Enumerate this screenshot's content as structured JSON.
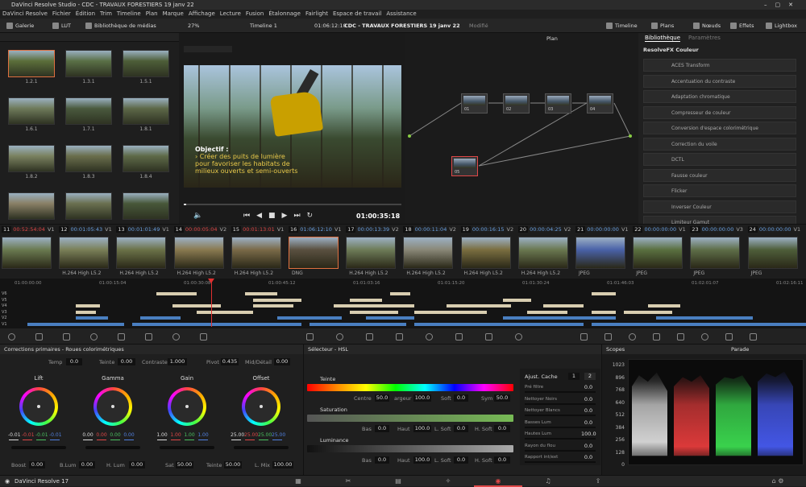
{
  "window": {
    "title": "DaVinci Resolve Studio - CDC - TRAVAUX FORESTIERS 19 janv 22"
  },
  "menu": [
    "DaVinci Resolve",
    "Fichier",
    "Édition",
    "Trim",
    "Timeline",
    "Plan",
    "Marque",
    "Affichage",
    "Lecture",
    "Fusion",
    "Étalonnage",
    "Fairlight",
    "Espace de travail",
    "Assistance"
  ],
  "toolbar": {
    "galerie": "Galerie",
    "lut": "LUT",
    "media": "Bibliothèque de médias",
    "zoom": "27%",
    "timeline_name": "Timeline 1",
    "timecode": "01:06:12:10",
    "project": "CDC - TRAVAUX FORESTIERS 19 janv 22",
    "modified": "Modifié",
    "timeline": "Timeline",
    "plans": "Plans",
    "noeuds": "Nœuds",
    "effets": "Effets",
    "lightbox": "Lightbox"
  },
  "gallery": {
    "labels": [
      "1.2.1",
      "1.3.1",
      "1.5.1",
      "1.6.1",
      "1.7.1",
      "1.8.1",
      "1.8.2",
      "1.8.3",
      "1.8.4",
      "",
      "",
      ""
    ]
  },
  "viewer": {
    "overlay_title": "Objectif :",
    "overlay_lines": [
      "› Créer des puits de lumière",
      "pour favoriser les habitats de",
      "milieux ouverts et semi-ouverts"
    ],
    "timecode": "01:00:35:18",
    "plan_label": "Plan"
  },
  "nodes": [
    "01",
    "02",
    "03",
    "04",
    "05"
  ],
  "library": {
    "tab1": "Bibliothèque",
    "tab2": "Paramètres",
    "section": "ResolveFX Couleur",
    "items": [
      "ACES Transform",
      "Accentuation du contraste",
      "Adaptation chromatique",
      "Compresseur de couleur",
      "Conversion d'espace colorimétrique",
      "Correction du voile",
      "DCTL",
      "Fausse couleur",
      "Flicker",
      "Inverser Couleur",
      "Limiteur Gamut"
    ]
  },
  "clips": [
    {
      "n": "11",
      "tc": "00:52:54:04",
      "tr": "V1",
      "codec": "",
      "red": true
    },
    {
      "n": "12",
      "tc": "00:01:05:43",
      "tr": "V1",
      "codec": "H.264 High L5.2",
      "red": false
    },
    {
      "n": "13",
      "tc": "00:01:01:49",
      "tr": "V1",
      "codec": "H.264 High L5.2",
      "red": false
    },
    {
      "n": "14",
      "tc": "00:00:05:04",
      "tr": "V2",
      "codec": "H.264 High L5.2",
      "red": true
    },
    {
      "n": "15",
      "tc": "00:01:13:01",
      "tr": "V1",
      "codec": "H.264 High L5.2",
      "red": true
    },
    {
      "n": "16",
      "tc": "01:06:12:10",
      "tr": "V1",
      "codec": "DNG",
      "red": false
    },
    {
      "n": "17",
      "tc": "00:00:13:39",
      "tr": "V2",
      "codec": "H.264 High L5.2",
      "red": false
    },
    {
      "n": "18",
      "tc": "00:00:11:04",
      "tr": "V2",
      "codec": "H.264 High L5.2",
      "red": false
    },
    {
      "n": "19",
      "tc": "00:00:16:15",
      "tr": "V2",
      "codec": "H.264 High L5.2",
      "red": false
    },
    {
      "n": "20",
      "tc": "00:00:04:25",
      "tr": "V2",
      "codec": "H.264 High L5.2",
      "red": false
    },
    {
      "n": "21",
      "tc": "00:00:00:00",
      "tr": "V1",
      "codec": "JPEG",
      "red": false
    },
    {
      "n": "22",
      "tc": "00:00:00:00",
      "tr": "V1",
      "codec": "JPEG",
      "red": false
    },
    {
      "n": "23",
      "tc": "00:00:00:00",
      "tr": "V3",
      "codec": "JPEG",
      "red": false
    },
    {
      "n": "24",
      "tc": "00:00:00:00",
      "tr": "V1",
      "codec": "JPEG",
      "red": false
    }
  ],
  "ruler": [
    "01:00:00:00",
    "01:00:15:04",
    "01:00:30:08",
    "01:00:45:12",
    "01:01:03:16",
    "01:01:15:20",
    "01:01:30:24",
    "01:01:46:03",
    "01:02:01:07",
    "01:02:16:11"
  ],
  "tracks": [
    "V6",
    "V5",
    "V4",
    "V3",
    "V2",
    "V1"
  ],
  "primaries": {
    "title": "Corrections primaires - Roues colorimétriques",
    "temp_label": "Temp",
    "temp": "0.0",
    "teinte_label": "Teinte",
    "teinte": "0.00",
    "contraste_label": "Contraste",
    "contraste": "1.000",
    "pivot_label": "Pivot",
    "pivot": "0.435",
    "mid_label": "Mid/Détail",
    "mid": "0.00",
    "wheels": [
      {
        "name": "Lift",
        "vals": [
          "-0.01",
          "-0.01",
          "-0.01",
          "-0.01"
        ]
      },
      {
        "name": "Gamma",
        "vals": [
          "0.00",
          "0.00",
          "0.00",
          "0.00"
        ]
      },
      {
        "name": "Gain",
        "vals": [
          "1.00",
          "1.00",
          "1.00",
          "1.00"
        ]
      },
      {
        "name": "Offset",
        "vals": [
          "25.00",
          "25.00",
          "25.00",
          "25.00"
        ]
      }
    ],
    "boost_label": "Boost",
    "boost": "0.00",
    "blum_label": "B.Lum",
    "blum": "0.00",
    "hlum_label": "H. Lum",
    "hlum": "0.00",
    "sat_label": "Sat",
    "sat": "50.00",
    "teinte2_label": "Teinte",
    "teinte2": "50.00",
    "lmix_label": "L. Mix",
    "lmix": "100.00"
  },
  "hsl": {
    "title": "Sélecteur - HSL",
    "teinte": "Teinte",
    "centre_label": "Centre",
    "centre": "50.0",
    "largeur_label": "argeur",
    "largeur": "100.0",
    "soft_label": "Soft",
    "soft": "0.0",
    "sym_label": "Sym",
    "sym": "50.0",
    "saturation": "Saturation",
    "bas_label": "Bas",
    "bas": "0.0",
    "haut_label": "Haut",
    "haut": "100.0",
    "lsoft_label": "L. Soft",
    "lsoft": "0.0",
    "hsoft_label": "H. Soft",
    "hsoft": "0.0",
    "luminance": "Luminance",
    "bas2": "0.0",
    "haut2": "100.0",
    "lsoft2": "0.0",
    "hsoft2": "0.0",
    "ajust": "Ajust. Cache",
    "ajust1": "1",
    "ajust2": "2",
    "params": [
      {
        "l": "Pré filtre",
        "v": "0.0"
      },
      {
        "l": "Nettoyer Noirs",
        "v": "0.0"
      },
      {
        "l": "Nettoyer Blancs",
        "v": "0.0"
      },
      {
        "l": "Basses Lum",
        "v": "0.0"
      },
      {
        "l": "Hautes Lum",
        "v": "100.0"
      },
      {
        "l": "Rayon du flou",
        "v": "0.0"
      },
      {
        "l": "Rapport int/ext",
        "v": "0.0"
      }
    ]
  },
  "scopes": {
    "title": "Scopes",
    "mode": "Parade",
    "scale": [
      "1023",
      "896",
      "768",
      "640",
      "512",
      "384",
      "256",
      "128",
      "0"
    ]
  },
  "status": {
    "app": "DaVinci Resolve 17"
  },
  "colors": {
    "accent": "#e04848",
    "blue_clip": "#4a7fc0",
    "beige_clip": "#d8cdb0"
  }
}
